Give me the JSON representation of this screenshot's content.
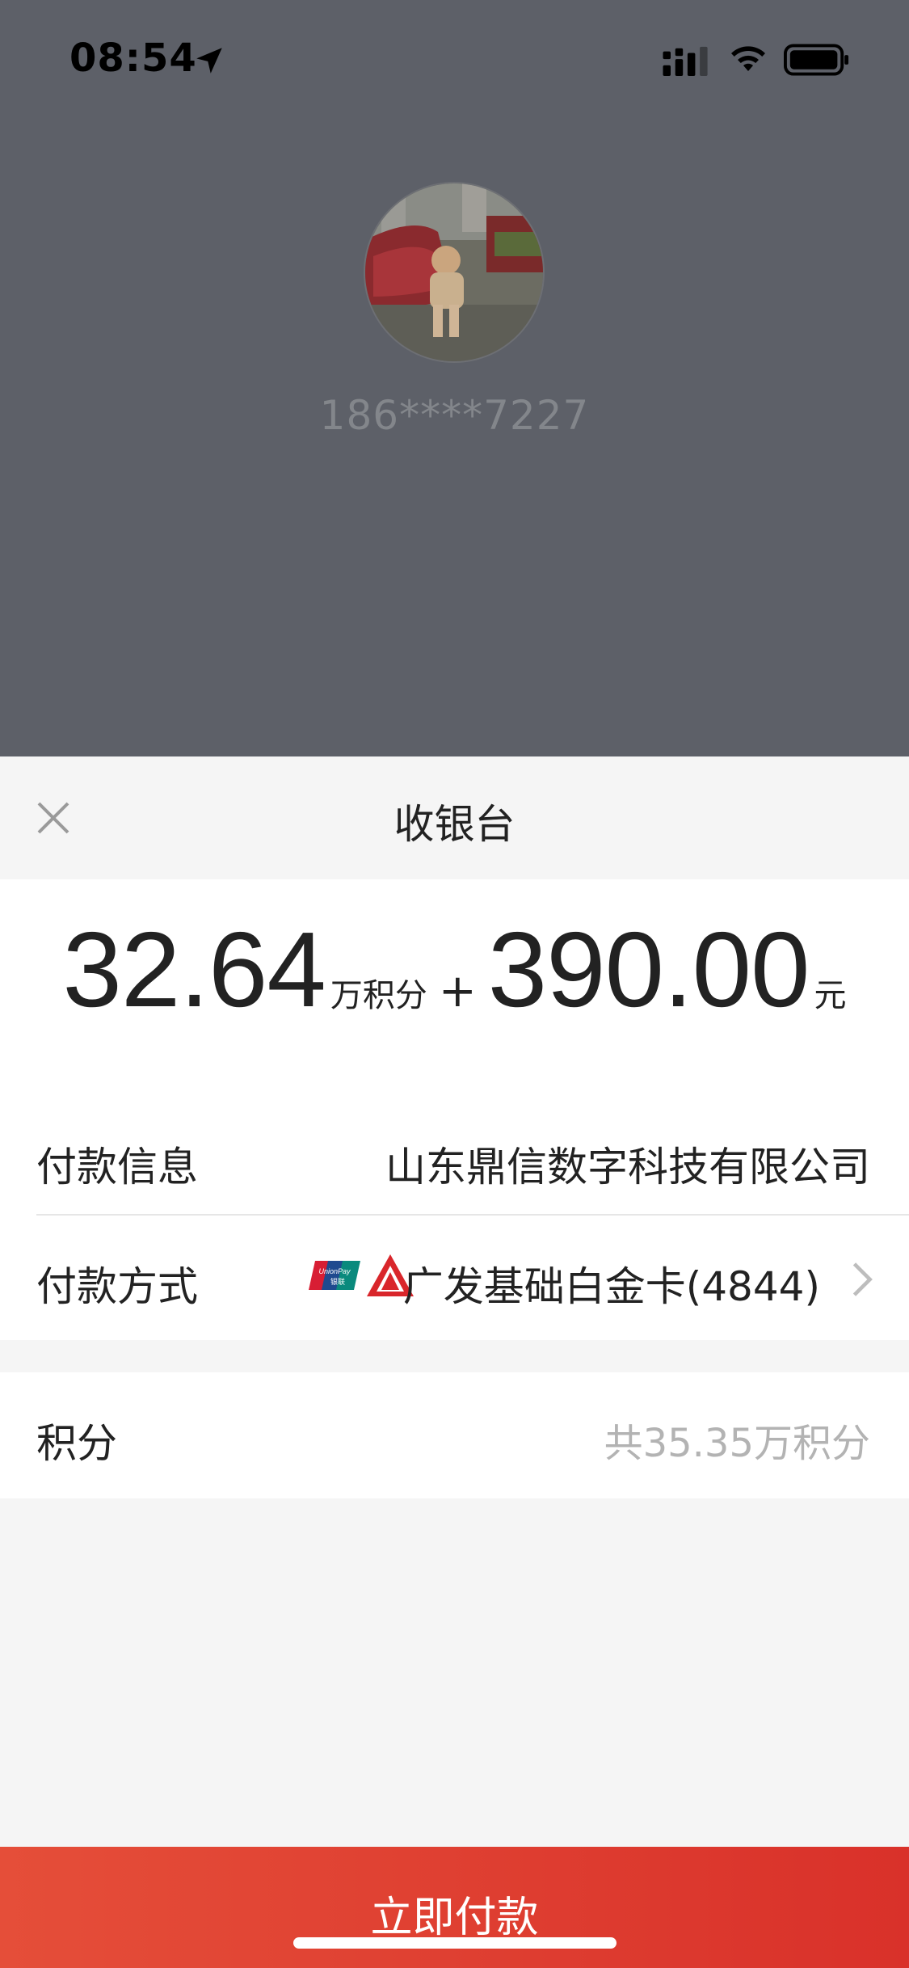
{
  "status_bar": {
    "time": "08:54",
    "icons": [
      "location-arrow-icon",
      "cellular-signal-icon",
      "wifi-icon",
      "battery-icon"
    ]
  },
  "payee": {
    "avatar": "avatar-photo",
    "phone": "186****7227"
  },
  "sheet": {
    "title": "收银台",
    "close_icon": "close-icon"
  },
  "amount": {
    "points_value": "32.64",
    "points_unit": "万积分",
    "plus": "+",
    "cash_value": "390.00",
    "cash_unit": "元"
  },
  "payment_info": {
    "label": "付款信息",
    "value": "山东鼎信数字科技有限公司"
  },
  "payment_method": {
    "label": "付款方式",
    "card": "广发基础白金卡(4844)",
    "icons": [
      "unionpay-icon",
      "gf-bank-icon",
      "chevron-right-icon"
    ]
  },
  "points": {
    "label": "积分",
    "balance": "共35.35万积分"
  },
  "pay_button": {
    "label": "立即付款"
  },
  "colors": {
    "backdrop": "#5d6068",
    "sheet_bg": "#f5f5f5",
    "primary_red": "#e0412f",
    "muted_text": "#b3b3b3"
  }
}
